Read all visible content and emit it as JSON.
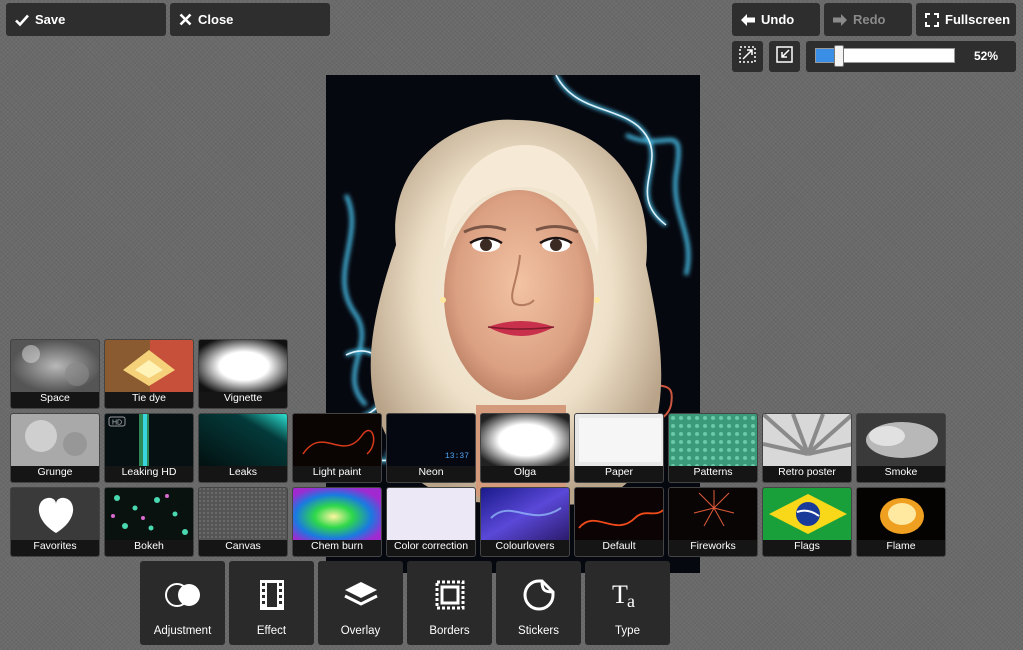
{
  "toolbar": {
    "save": "Save",
    "close": "Close",
    "undo": "Undo",
    "redo": "Redo",
    "fullscreen": "Fullscreen"
  },
  "zoom": {
    "percent_label": "52%",
    "value": 0.52
  },
  "overlay_rows": [
    [
      "Space",
      "Tie dye",
      "Vignette"
    ],
    [
      "Grunge",
      "Leaking HD",
      "Leaks",
      "Light paint",
      "Neon",
      "Olga",
      "Paper",
      "Patterns",
      "Retro poster",
      "Smoke"
    ],
    [
      "Favorites",
      "Bokeh",
      "Canvas",
      "Chem burn",
      "Color correction",
      "Colourlovers",
      "Default",
      "Fireworks",
      "Flags",
      "Flame"
    ]
  ],
  "tools": [
    "Adjustment",
    "Effect",
    "Overlay",
    "Borders",
    "Stickers",
    "Type"
  ],
  "badges": {
    "hd": "HD",
    "neon_time": "13:37"
  },
  "colors": {
    "zoom_fill": "#3a8ee6",
    "button_bg": "#2e2e2e"
  }
}
